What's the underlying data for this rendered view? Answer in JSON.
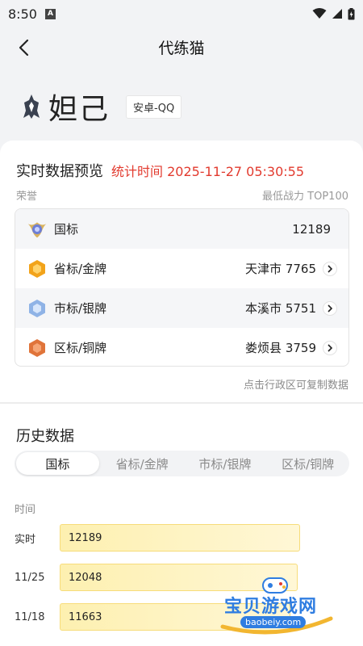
{
  "status_bar": {
    "time": "8:50",
    "notification_icon": "A"
  },
  "header": {
    "title": "代练猫"
  },
  "hero": {
    "name": "妲己",
    "platform": "安卓-QQ"
  },
  "realtime": {
    "title": "实时数据预览",
    "stat_time": "统计时间 2025-11-27 05:30:55",
    "left_label": "荣誉",
    "right_label": "最低战力 TOP100",
    "rows": [
      {
        "label": "国标",
        "value": "12189",
        "badge_color": "#7a8ad8"
      },
      {
        "label": "省标/金牌",
        "value": "天津市 7765",
        "badge_color": "#f2a31a"
      },
      {
        "label": "市标/银牌",
        "value": "本溪市 5751",
        "badge_color": "#8fb3e6"
      },
      {
        "label": "区标/铜牌",
        "value": "娄烦县 3759",
        "badge_color": "#e0743a"
      }
    ],
    "copy_hint": "点击行政区可复制数据"
  },
  "history": {
    "title": "历史数据",
    "tabs": [
      "国标",
      "省标/金牌",
      "市标/银牌",
      "区标/铜牌"
    ],
    "active_tab": "国标",
    "column_header": "时间",
    "rows": [
      {
        "date": "实时",
        "value": "12189",
        "fill": 1.0
      },
      {
        "date": "11/25",
        "value": "12048",
        "fill": 0.99
      },
      {
        "date": "11/18",
        "value": "11663",
        "fill": 0.96
      }
    ]
  },
  "watermark": {
    "text": "宝贝游戏网",
    "url": "baobeiy.com"
  }
}
